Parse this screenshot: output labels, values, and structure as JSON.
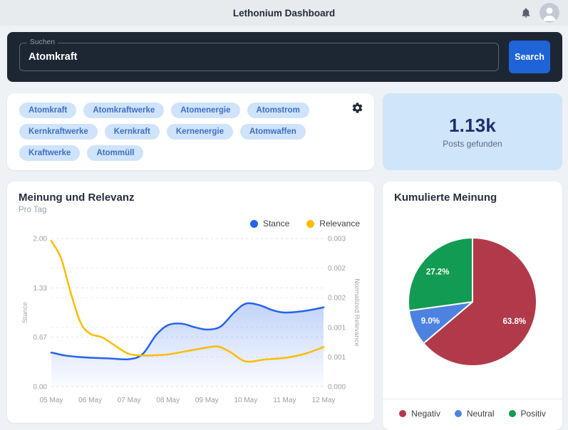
{
  "header": {
    "title": "Lethonium Dashboard"
  },
  "search": {
    "label": "Suchen",
    "value": "Atomkraft",
    "button_label": "Search"
  },
  "keywords": {
    "chips": [
      "Atomkraft",
      "Atomkraftwerke",
      "Atomenergie",
      "Atomstrom",
      "Kernkraftwerke",
      "Kernkraft",
      "Kernenergie",
      "Atomwaffen",
      "Kraftwerke",
      "Atommüll"
    ]
  },
  "stats": {
    "value": "1.13k",
    "label": "Posts gefunden"
  },
  "colors": {
    "accent": "#1e64d8",
    "panel_dark": "#1d2633",
    "chip_bg": "#cfe3fa",
    "chip_text": "#3d6fc4",
    "stat_bg": "#cfe5f9",
    "stat_value": "#1b2f6e",
    "stance_line": "#2563eb",
    "relevance_line": "#fbbc04",
    "negativ": "#b13a4a",
    "neutral": "#4d82e0",
    "positiv": "#129b52"
  },
  "icons": [
    "bell-icon",
    "avatar-icon",
    "gear-icon"
  ],
  "chart_data": [
    {
      "type": "line",
      "title": "Meinung und Relevanz",
      "subtitle": "Pro Tag",
      "x_tick_labels": [
        "05 May",
        "06 May",
        "07 May",
        "08 May",
        "09 May",
        "10 May",
        "11 May",
        "12 May"
      ],
      "x_range": [
        5,
        12
      ],
      "grid": "horizontal-dashed",
      "legend_position": "top-right",
      "left_axis": {
        "label": "Stance",
        "range": [
          0,
          2
        ],
        "tick_labels_top_to_bottom": [
          "2.00",
          "1.33",
          "0.67",
          "0.00"
        ]
      },
      "right_axis": {
        "label": "Normalized Relevance",
        "range": [
          0,
          0.003
        ],
        "tick_labels_top_to_bottom": [
          "0.003",
          "0.002",
          "0.002",
          "0.001",
          "0.001",
          "0.000"
        ]
      },
      "series": [
        {
          "name": "Stance",
          "axis": "left",
          "color": "#2563eb",
          "area_fill": true,
          "x": [
            5,
            5.35,
            5.7,
            6,
            6.5,
            7,
            7.35,
            7.7,
            8,
            8.35,
            8.7,
            9,
            9.35,
            9.7,
            10,
            10.35,
            10.7,
            11,
            11.5,
            12
          ],
          "values": [
            0.46,
            0.42,
            0.4,
            0.39,
            0.38,
            0.37,
            0.44,
            0.7,
            0.83,
            0.85,
            0.8,
            0.77,
            0.81,
            1.0,
            1.12,
            1.1,
            1.03,
            1.0,
            1.02,
            1.07
          ]
        },
        {
          "name": "Relevance",
          "axis": "right",
          "color": "#fbbc04",
          "area_fill": false,
          "x": [
            5,
            5.25,
            5.5,
            5.75,
            6,
            6.3,
            6.6,
            7,
            7.4,
            7.8,
            8,
            8.5,
            9,
            9.3,
            9.6,
            10,
            10.5,
            11,
            11.5,
            12
          ],
          "values": [
            0.00295,
            0.0026,
            0.0019,
            0.0013,
            0.00107,
            0.001,
            0.00085,
            0.00066,
            0.00063,
            0.00064,
            0.00065,
            0.00072,
            0.00079,
            0.00081,
            0.0007,
            0.00051,
            0.00055,
            0.00058,
            0.00066,
            0.0008
          ]
        }
      ]
    },
    {
      "type": "pie",
      "title": "Kumulierte Meinung",
      "start_angle": "top",
      "direction": "clockwise",
      "legend_position": "bottom",
      "slices": [
        {
          "label": "Negativ",
          "value_pct": 63.8,
          "display": "63.8%",
          "color": "#b13a4a"
        },
        {
          "label": "Neutral",
          "value_pct": 9.0,
          "display": "9.0%",
          "color": "#4d82e0"
        },
        {
          "label": "Positiv",
          "value_pct": 27.2,
          "display": "27.2%",
          "color": "#129b52"
        }
      ]
    }
  ]
}
